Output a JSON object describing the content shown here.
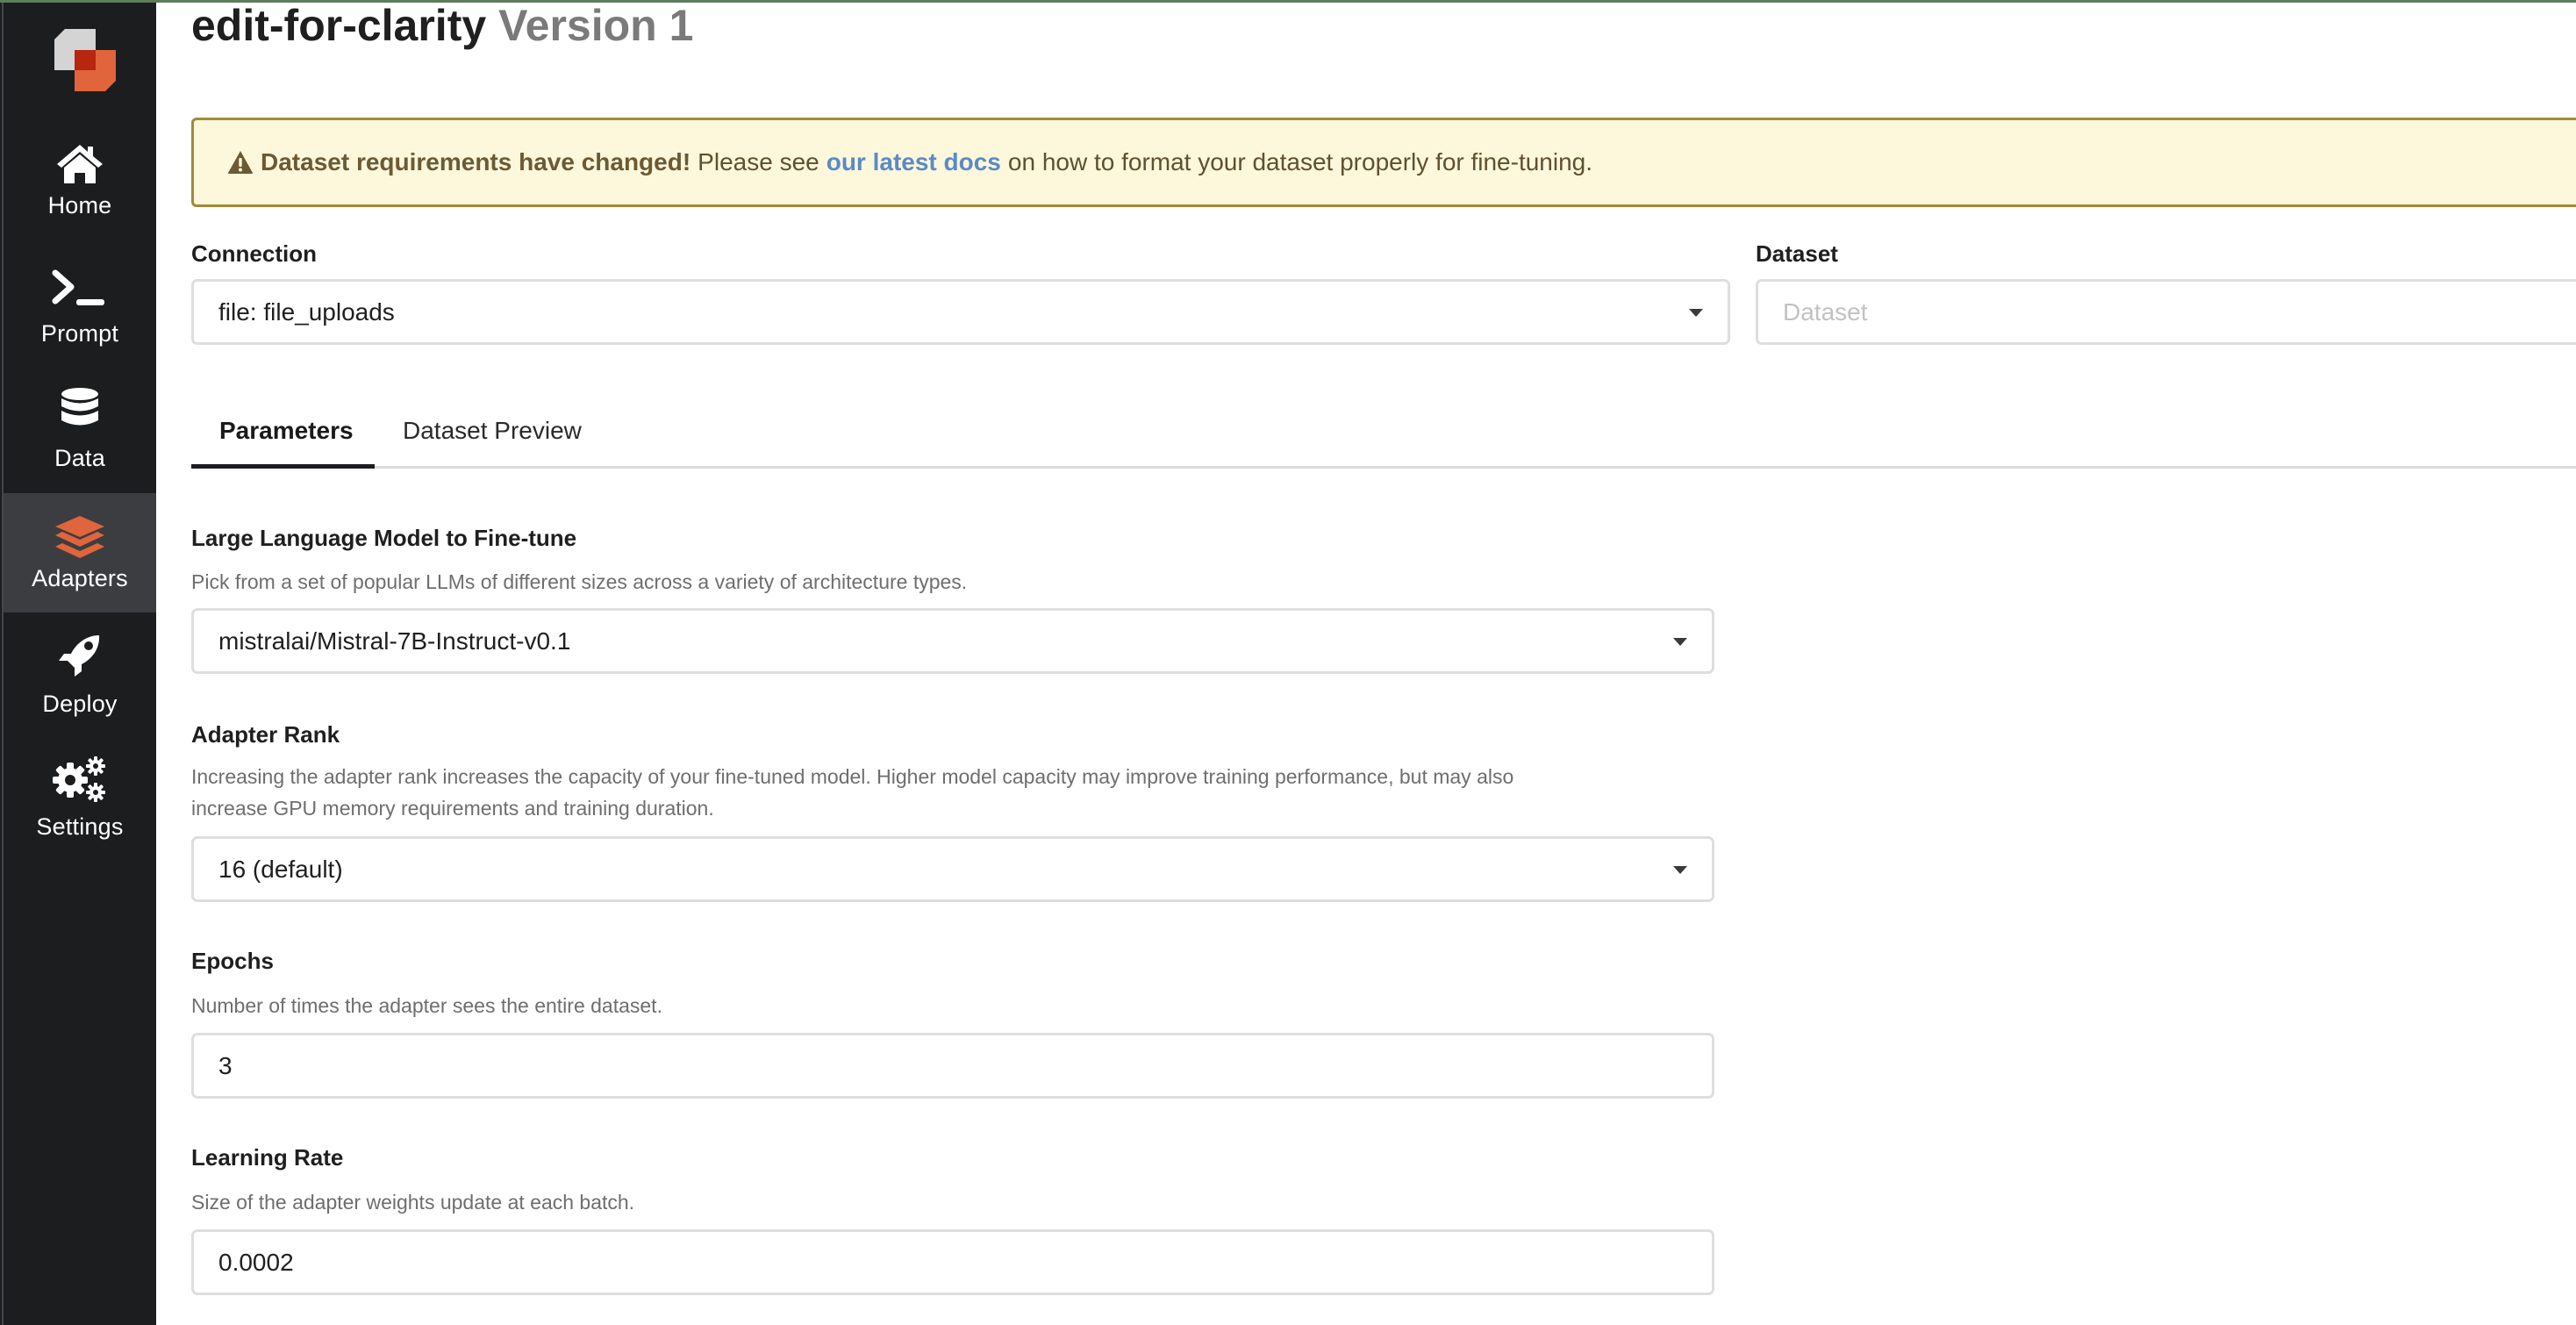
{
  "app": {
    "brand_colors": {
      "primary": "#e0643c",
      "sidebar_bg": "#1c1d1f",
      "sidebar_active_bg": "#3c3d40"
    }
  },
  "sidebar": {
    "items": [
      {
        "label": "Home",
        "icon": "home-icon",
        "active": false
      },
      {
        "label": "Prompt",
        "icon": "terminal-prompt-icon",
        "active": false
      },
      {
        "label": "Data",
        "icon": "database-icon",
        "active": false
      },
      {
        "label": "Adapters",
        "icon": "layers-icon",
        "active": true
      },
      {
        "label": "Deploy",
        "icon": "rocket-icon",
        "active": false
      },
      {
        "label": "Settings",
        "icon": "gears-icon",
        "active": false
      }
    ]
  },
  "header": {
    "title": "edit-for-clarity",
    "version": "Version 1"
  },
  "banner": {
    "icon": "warning-triangle-icon",
    "bold_text": "Dataset requirements have changed!",
    "pre_link": "Please see",
    "link_text": "our latest docs",
    "post_link": "on how to format your dataset properly for fine-tuning.",
    "colors": {
      "background": "#fdf7dc",
      "border": "#a38a38",
      "link": "#5b8ac6"
    }
  },
  "connection": {
    "label": "Connection",
    "value": "file: file_uploads"
  },
  "dataset": {
    "label": "Dataset",
    "value": "",
    "placeholder": "Dataset"
  },
  "tabs": [
    {
      "label": "Parameters",
      "active": true
    },
    {
      "label": "Dataset Preview",
      "active": false
    }
  ],
  "parameters": {
    "llm": {
      "label": "Large Language Model to Fine-tune",
      "description": "Pick from a set of popular LLMs of different sizes across a variety of architecture types.",
      "value": "mistralai/Mistral-7B-Instruct-v0.1"
    },
    "adapter_rank": {
      "label": "Adapter Rank",
      "description_line1": "Increasing the adapter rank increases the capacity of your fine-tuned model. Higher model capacity may improve training performance, but may also",
      "description_line2": "increase GPU memory requirements and training duration.",
      "value": "16 (default)"
    },
    "epochs": {
      "label": "Epochs",
      "description": "Number of times the adapter sees the entire dataset.",
      "value": "3"
    },
    "learning_rate": {
      "label": "Learning Rate",
      "description": "Size of the adapter weights update at each batch.",
      "value": "0.0002"
    }
  }
}
